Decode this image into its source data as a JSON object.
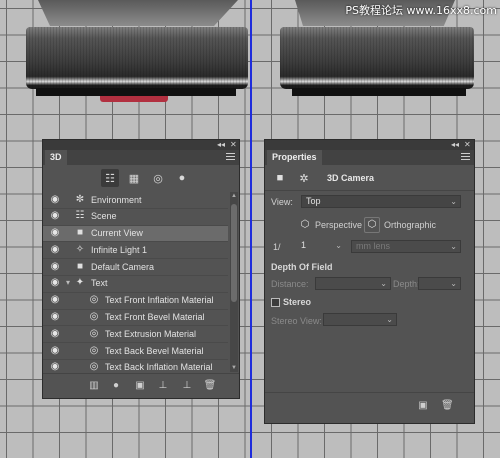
{
  "watermark": "PS教程论坛 www.16xx8.com",
  "panel3d": {
    "tab": "3D",
    "collapse": "◂◂",
    "close": "✕",
    "filter_icons": [
      "scene-icon",
      "mesh-icon",
      "material-icon",
      "light-icon"
    ],
    "layers": [
      {
        "label": "Environment",
        "icon": "environment-icon",
        "glyph": "✼",
        "visible": true,
        "caret": ""
      },
      {
        "label": "Scene",
        "icon": "scene-icon",
        "glyph": "☷",
        "visible": true,
        "caret": ""
      },
      {
        "label": "Current View",
        "icon": "camera-icon",
        "glyph": "■",
        "visible": true,
        "caret": "",
        "selected": true
      },
      {
        "label": "Infinite Light 1",
        "icon": "infinite-light-icon",
        "glyph": "✧",
        "visible": true,
        "caret": ""
      },
      {
        "label": "Default Camera",
        "icon": "camera-icon",
        "glyph": "■",
        "visible": true,
        "caret": ""
      },
      {
        "label": "Text",
        "icon": "text-mesh-icon",
        "glyph": "✦",
        "visible": true,
        "caret": "▾"
      },
      {
        "label": "Text Front Inflation Material",
        "icon": "material-icon",
        "glyph": "◎",
        "visible": true,
        "caret": ""
      },
      {
        "label": "Text Front Bevel Material",
        "icon": "material-icon",
        "glyph": "◎",
        "visible": true,
        "caret": ""
      },
      {
        "label": "Text Extrusion Material",
        "icon": "material-icon",
        "glyph": "◎",
        "visible": true,
        "caret": ""
      },
      {
        "label": "Text Back Bevel Material",
        "icon": "material-icon",
        "glyph": "◎",
        "visible": true,
        "caret": ""
      },
      {
        "label": "Text Back Inflation Material",
        "icon": "material-icon",
        "glyph": "◎",
        "visible": true,
        "caret": ""
      }
    ]
  },
  "properties": {
    "tab": "Properties",
    "collapse": "◂◂",
    "close": "✕",
    "section_title": "3D Camera",
    "view_label": "View:",
    "view_value": "Top",
    "perspective_label": "Perspective",
    "orthographic_label": "Orthographic",
    "fov_prefix": "1/",
    "fov_value": "1",
    "lens_placeholder": "mm lens",
    "dof_title": "Depth Of Field",
    "distance_label": "Distance:",
    "depth_label": "Depth:",
    "stereo_label": "Stereo",
    "stereo_view_label": "Stereo View:"
  }
}
